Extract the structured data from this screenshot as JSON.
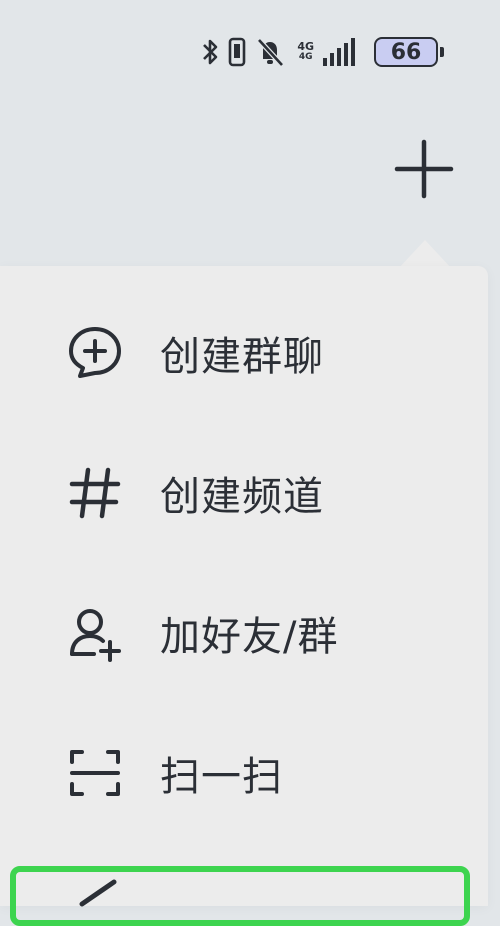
{
  "status_bar": {
    "network_type_top": "4G",
    "network_type_bottom": "4G",
    "battery_level": "66"
  },
  "menu": {
    "items": [
      {
        "label": "创建群聊",
        "icon": "create-group-chat-icon"
      },
      {
        "label": "创建频道",
        "icon": "hash-channel-icon"
      },
      {
        "label": "加好友/群",
        "icon": "add-friend-icon"
      },
      {
        "label": "扫一扫",
        "icon": "scan-icon"
      }
    ]
  },
  "colors": {
    "background": "#e2e6e9",
    "menu_background": "#ececec",
    "highlight": "#3dd44f",
    "text": "#2b2f36"
  }
}
